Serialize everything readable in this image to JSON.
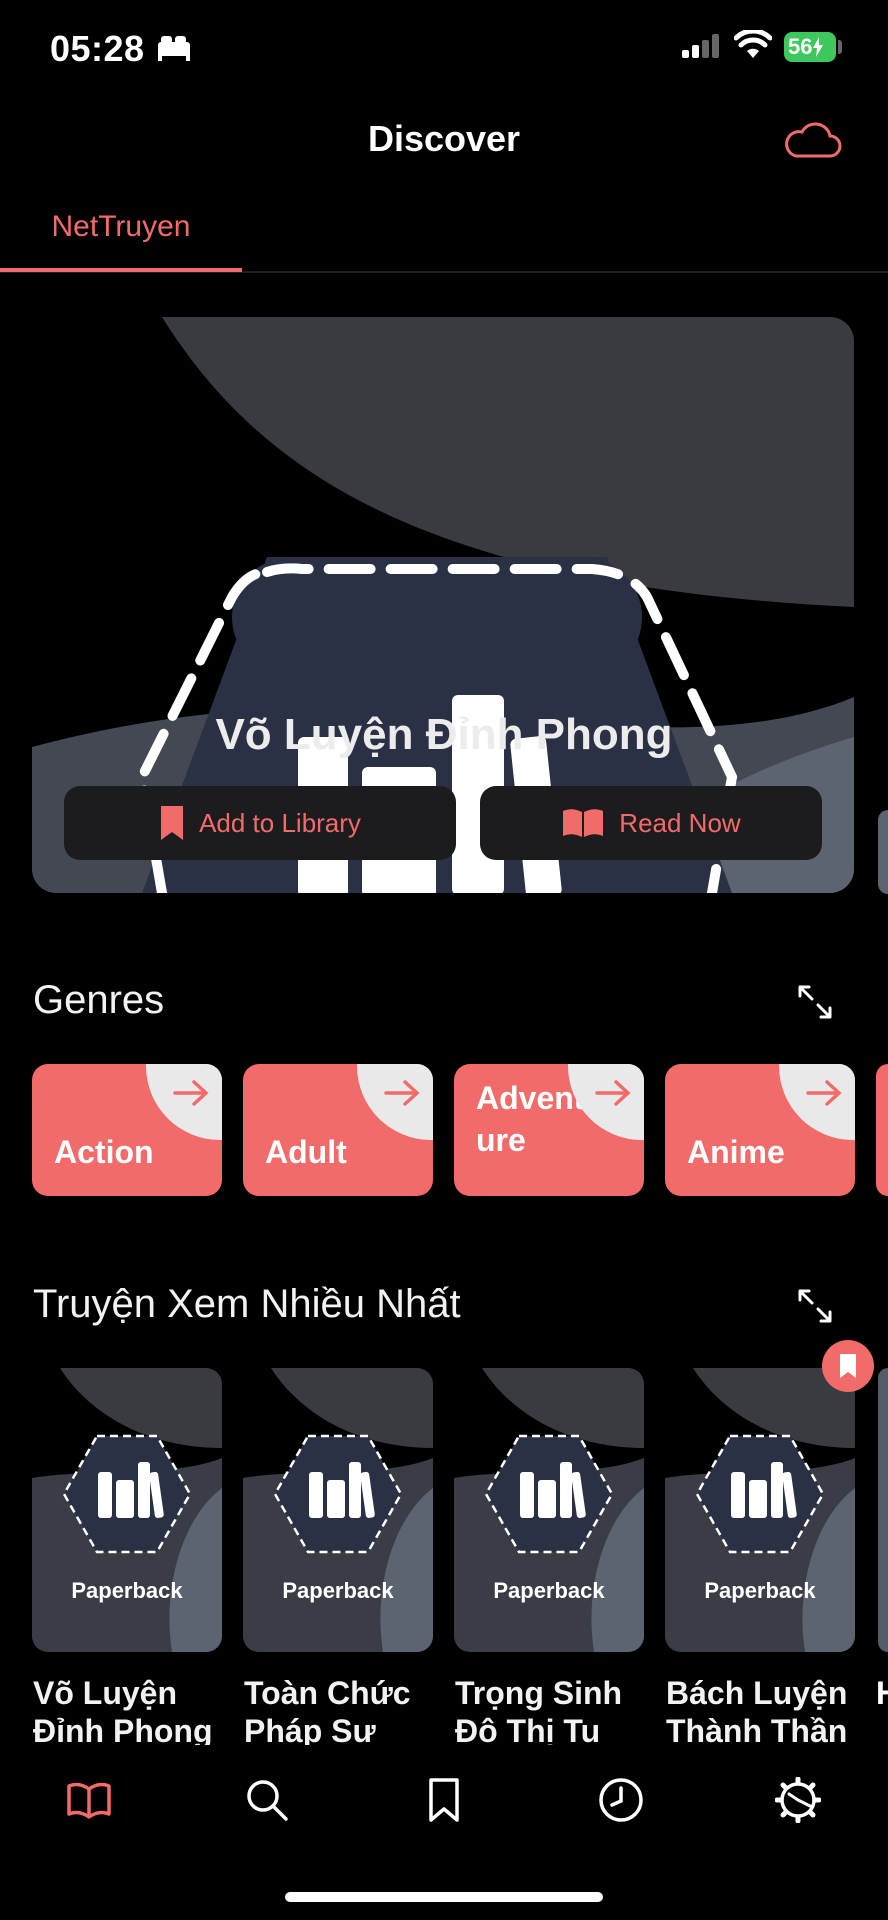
{
  "status_bar": {
    "time": "05:28",
    "battery": "56"
  },
  "header": {
    "title": "Discover"
  },
  "tabs": [
    {
      "label": "NetTruyen",
      "active": true
    }
  ],
  "featured": {
    "title": "Võ Luyện Đỉnh Phong",
    "add_label": "Add to Library",
    "read_label": "Read Now"
  },
  "genres_section": {
    "title": "Genres",
    "items": [
      {
        "label": "Action"
      },
      {
        "label": "Adult"
      },
      {
        "label": "Adventure"
      },
      {
        "label": "Anime"
      }
    ]
  },
  "popular_section": {
    "title": "Truyện Xem Nhiều Nhất",
    "cover_label": "Paperback",
    "items": [
      {
        "title": "Võ Luyện Đỉnh Phong"
      },
      {
        "title": "Toàn Chức Pháp Sư"
      },
      {
        "title": "Trọng Sinh Đô Thị Tu Tiên"
      },
      {
        "title": "Bách Luyện Thành Thần"
      },
      {
        "title": "H"
      }
    ]
  },
  "bottom_nav": [
    {
      "name": "library",
      "icon": "book-icon",
      "active": true
    },
    {
      "name": "search",
      "icon": "search-icon"
    },
    {
      "name": "bookmarks",
      "icon": "bookmark-icon"
    },
    {
      "name": "history",
      "icon": "clock-icon"
    },
    {
      "name": "settings",
      "icon": "gear-icon"
    }
  ],
  "colors": {
    "accent": "#f26b6b",
    "background": "#000000",
    "card": "#1c1c1e",
    "cover_dark": "#2b3145"
  }
}
